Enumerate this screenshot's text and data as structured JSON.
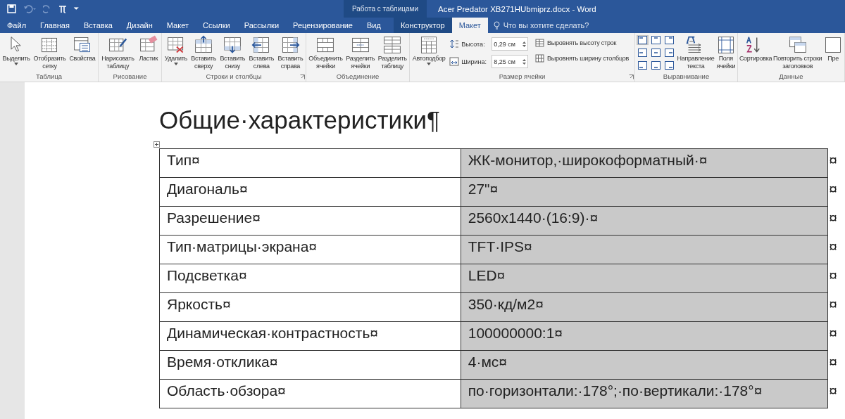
{
  "quick_access": {
    "customize": "⏷"
  },
  "context_group": "Работа с таблицами",
  "window": {
    "title": "Acer Predator XB271HUbmiprz.docx - Word"
  },
  "tabs": [
    {
      "label": "Файл",
      "selected": false,
      "contextual": false
    },
    {
      "label": "Главная",
      "selected": false,
      "contextual": false
    },
    {
      "label": "Вставка",
      "selected": false,
      "contextual": false
    },
    {
      "label": "Дизайн",
      "selected": false,
      "contextual": false
    },
    {
      "label": "Макет",
      "selected": false,
      "contextual": false
    },
    {
      "label": "Ссылки",
      "selected": false,
      "contextual": false
    },
    {
      "label": "Рассылки",
      "selected": false,
      "contextual": false
    },
    {
      "label": "Рецензирование",
      "selected": false,
      "contextual": false
    },
    {
      "label": "Вид",
      "selected": false,
      "contextual": false
    },
    {
      "label": "Конструктор",
      "selected": false,
      "contextual": true
    },
    {
      "label": "Макет",
      "selected": true,
      "contextual": true
    }
  ],
  "tell_me": {
    "placeholder": "Что вы хотите сделать?"
  },
  "ribbon": [
    {
      "label": "Таблица",
      "launcher": false,
      "items": [
        {
          "kind": "button",
          "label": "Выделить",
          "dropdown": true
        },
        {
          "kind": "button",
          "label": "Отобразить\nсетку",
          "dropdown": false
        },
        {
          "kind": "button",
          "label": "Свойства",
          "dropdown": false
        }
      ]
    },
    {
      "label": "Рисование",
      "launcher": false,
      "items": [
        {
          "kind": "button",
          "label": "Нарисовать\nтаблицу",
          "dropdown": false
        },
        {
          "kind": "button",
          "label": "Ластик",
          "dropdown": false
        }
      ]
    },
    {
      "label": "Строки и столбцы",
      "launcher": true,
      "items": [
        {
          "kind": "button",
          "label": "Удалить",
          "dropdown": true
        },
        {
          "kind": "button",
          "label": "Вставить\nсверху",
          "dropdown": false
        },
        {
          "kind": "button",
          "label": "Вставить\nснизу",
          "dropdown": false
        },
        {
          "kind": "button",
          "label": "Вставить\nслева",
          "dropdown": false
        },
        {
          "kind": "button",
          "label": "Вставить\nсправа",
          "dropdown": false
        }
      ]
    },
    {
      "label": "Объединение",
      "launcher": false,
      "items": [
        {
          "kind": "button",
          "label": "Объединить\nячейки",
          "dropdown": false
        },
        {
          "kind": "button",
          "label": "Разделить\nячейки",
          "dropdown": false
        },
        {
          "kind": "button",
          "label": "Разделить\nтаблицу",
          "dropdown": false
        }
      ]
    },
    {
      "label": "Размер ячейки",
      "launcher": true,
      "items": [
        {
          "kind": "button",
          "label": "Автоподбор",
          "dropdown": true
        },
        {
          "kind": "spinners",
          "fields": [
            {
              "label": "Высота:",
              "value": "0,29 см"
            },
            {
              "label": "Ширина:",
              "value": "8,25 см"
            }
          ]
        },
        {
          "kind": "commands",
          "commands": [
            "Выровнять высоту строк",
            "Выровнять ширину столбцов"
          ]
        }
      ]
    },
    {
      "label": "Выравнивание",
      "launcher": false,
      "items": [
        {
          "kind": "align_grid",
          "cells": [
            {
              "selected": true
            },
            {
              "selected": false
            },
            {
              "selected": false
            },
            {
              "selected": false
            },
            {
              "selected": false
            },
            {
              "selected": false
            },
            {
              "selected": false
            },
            {
              "selected": false
            },
            {
              "selected": false
            }
          ]
        },
        {
          "kind": "button",
          "label": "Направление\nтекста",
          "dropdown": false
        },
        {
          "kind": "button",
          "label": "Поля\nячейки",
          "dropdown": false
        }
      ]
    },
    {
      "label": "Данные",
      "launcher": false,
      "items": [
        {
          "kind": "button",
          "label": "Сортировка",
          "dropdown": false
        },
        {
          "kind": "button",
          "label": "Повторить строки\nзаголовков",
          "dropdown": false
        },
        {
          "kind": "button",
          "label": "Пре",
          "dropdown": false
        }
      ]
    }
  ],
  "document": {
    "heading": "Общие·характеристики¶",
    "table": {
      "rows": [
        {
          "cells": [
            {
              "text": "Тип¤",
              "selected": false
            },
            {
              "text": "ЖК-монитор,·широкоформатный·¤",
              "selected": true
            }
          ],
          "end_mark": "¤"
        },
        {
          "cells": [
            {
              "text": "Диагональ¤",
              "selected": false
            },
            {
              "text": "27\"¤",
              "selected": true
            }
          ],
          "end_mark": "¤"
        },
        {
          "cells": [
            {
              "text": "Разрешение¤",
              "selected": false
            },
            {
              "text": "2560x1440·(16:9)·¤",
              "selected": true
            }
          ],
          "end_mark": "¤"
        },
        {
          "cells": [
            {
              "text": "Тип·матрицы·экрана¤",
              "selected": false
            },
            {
              "text": "TFT·IPS¤",
              "selected": true
            }
          ],
          "end_mark": "¤"
        },
        {
          "cells": [
            {
              "text": "Подсветка¤",
              "selected": false
            },
            {
              "text": "LED¤",
              "selected": true
            }
          ],
          "end_mark": "¤"
        },
        {
          "cells": [
            {
              "text": "Яркость¤",
              "selected": false
            },
            {
              "text": "350·кд/м2¤",
              "selected": true
            }
          ],
          "end_mark": "¤"
        },
        {
          "cells": [
            {
              "text": "Динамическая·контрастность¤",
              "selected": false
            },
            {
              "text": "100000000:1¤",
              "selected": true
            }
          ],
          "end_mark": "¤"
        },
        {
          "cells": [
            {
              "text": "Время·отклика¤",
              "selected": false
            },
            {
              "text": "4·мс¤",
              "selected": true
            }
          ],
          "end_mark": "¤"
        },
        {
          "cells": [
            {
              "text": "Область·обзора¤",
              "selected": false
            },
            {
              "text": "по·горизонтали:·178°;·по·вертикали:·178°¤",
              "selected": true
            }
          ],
          "end_mark": "¤"
        }
      ]
    }
  }
}
